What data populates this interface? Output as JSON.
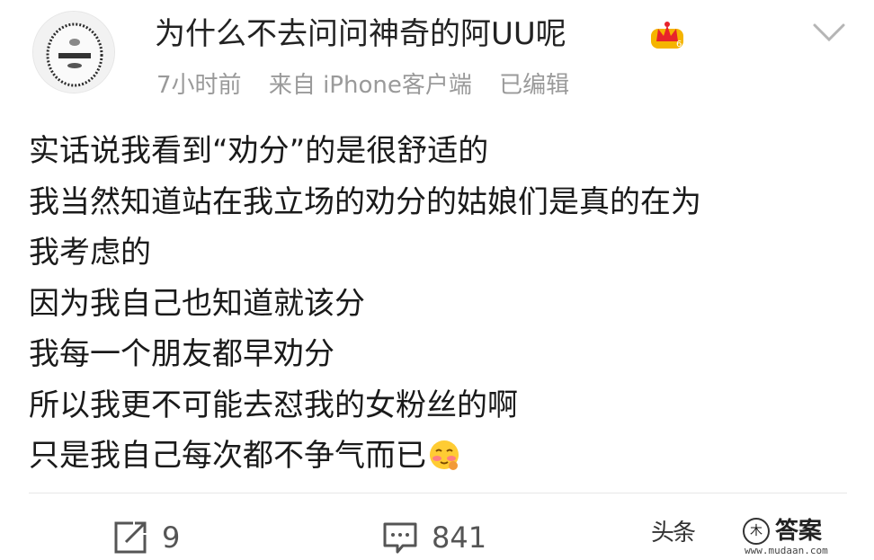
{
  "post": {
    "username": "为什么不去问问神奇的阿UU呢",
    "meta": {
      "time": "7小时前",
      "source": "来自 iPhone客户端",
      "edited": "已编辑"
    },
    "lines": [
      "实话说我看到“劝分”的是很舒适的",
      "我当然知道站在我立场的劝分的姑娘们是真的在为",
      "我考虑的",
      "因为我自己也知道就该分",
      "我每一个朋友都早劝分",
      "所以我更不可能去怼我的女粉丝的啊",
      "只是我自己每次都不争气而已"
    ],
    "actions": {
      "repost_count": "9",
      "comment_count": "841"
    }
  },
  "watermark": {
    "toutiao": "头条",
    "mudaan_title": "答案",
    "mudaan_url": "www.mudaan.com"
  },
  "icons": {
    "avatar": "avatar-image",
    "crown": "crown-icon",
    "chevron": "chevron-down-icon",
    "emoji": "blush-emoji-icon",
    "repost": "repost-icon",
    "comment": "comment-icon"
  },
  "colors": {
    "meta_text": "#9a9a9a",
    "crown_gold": "#f5b400",
    "divider": "#e8e8e8"
  }
}
